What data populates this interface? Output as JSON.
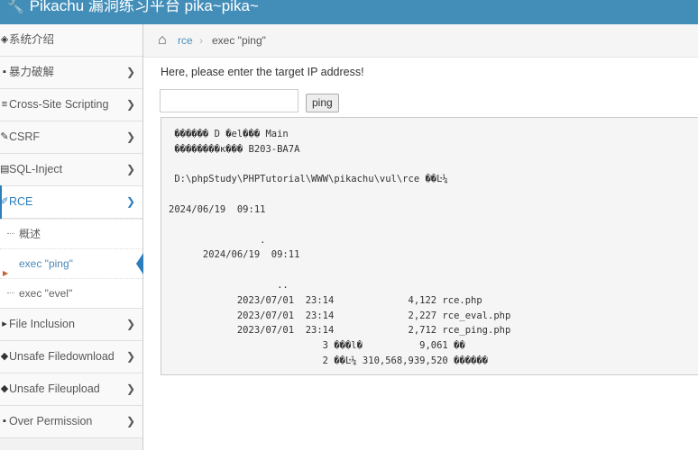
{
  "header": {
    "title": "Pikachu 漏洞练习平台 pika~pika~"
  },
  "sidebar": {
    "items": [
      {
        "label": "系统介绍",
        "icon": "eye-icon"
      },
      {
        "label": "暴力破解",
        "icon": "desktop-icon"
      },
      {
        "label": "Cross-Site Scripting",
        "icon": "list-icon"
      },
      {
        "label": "CSRF",
        "icon": "pencil-icon"
      },
      {
        "label": "SQL-Inject",
        "icon": "list-alt-icon"
      },
      {
        "label": "RCE",
        "icon": "edit-icon"
      },
      {
        "label": "File Inclusion",
        "icon": "tag-icon"
      },
      {
        "label": "Unsafe Filedownload",
        "icon": "download-icon"
      },
      {
        "label": "Unsafe Fileupload",
        "icon": "upload-icon"
      },
      {
        "label": "Over Permission",
        "icon": "user-icon"
      }
    ],
    "rce_sub": [
      "概述",
      "exec \"ping\"",
      "exec \"evel\""
    ]
  },
  "breadcrumb": {
    "link": "rce",
    "separator": "›",
    "current": "exec \"ping\""
  },
  "main": {
    "prompt": "Here, please enter the target IP address!",
    "input_value": "",
    "button_label": "ping",
    "output": " ������ D �el��� Main\n ��������к��� B203-BA7A\n\n D:\\phpStudy\\PHPTutorial\\WWW\\pikachu\\vul\\rce ��Ŀ¼\n\n2024/06/19  09:11\n\n                .\n      2024/06/19  09:11\n\n                   ..\n            2023/07/01  23:14             4,122 rce.php\n            2023/07/01  23:14             2,227 rce_eval.php\n            2023/07/01  23:14             2,712 rce_ping.php\n                           3 ���l�          9,061 ��\n                           2 ��Ŀ¼ 310,568,939,520 ������"
  }
}
